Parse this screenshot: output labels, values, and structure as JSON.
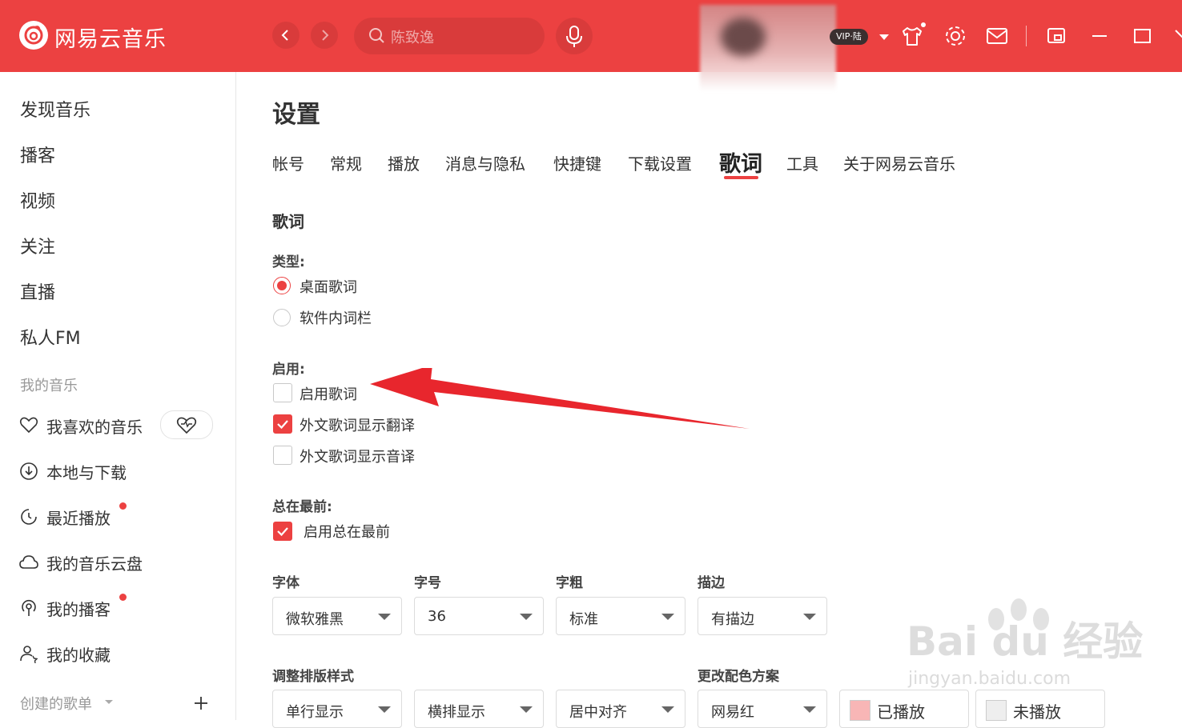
{
  "app": {
    "title": "网易云音乐",
    "search_placeholder": "陈致逸",
    "vip_badge": "VIP·陆",
    "accent_color": "#ec4141"
  },
  "sidebar": {
    "main_items": [
      "发现音乐",
      "播客",
      "视频",
      "关注",
      "直播",
      "私人FM"
    ],
    "my_music_label": "我的音乐",
    "my_items": [
      {
        "label": "我喜欢的音乐",
        "icon": "heart-icon",
        "dot": false
      },
      {
        "label": "本地与下载",
        "icon": "download-icon",
        "dot": false
      },
      {
        "label": "最近播放",
        "icon": "recent-play-icon",
        "dot": true
      },
      {
        "label": "我的音乐云盘",
        "icon": "cloud-icon",
        "dot": false
      },
      {
        "label": "我的播客",
        "icon": "podcast-icon",
        "dot": true
      },
      {
        "label": "我的收藏",
        "icon": "collection-icon",
        "dot": false
      }
    ],
    "created_playlists_label": "创建的歌单"
  },
  "settings": {
    "title": "设置",
    "tabs": [
      "帐号",
      "常规",
      "播放",
      "消息与隐私",
      "快捷键",
      "下载设置",
      "歌词",
      "工具",
      "关于网易云音乐"
    ],
    "active_tab": "歌词",
    "section_title": "歌词",
    "type_label": "类型:",
    "type_options": [
      {
        "label": "桌面歌词",
        "selected": true
      },
      {
        "label": "软件内词栏",
        "selected": false
      }
    ],
    "enable_label": "启用:",
    "enable_options": [
      {
        "label": "启用歌词",
        "checked": false
      },
      {
        "label": "外文歌词显示翻译",
        "checked": true
      },
      {
        "label": "外文歌词显示音译",
        "checked": false
      }
    ],
    "always_on_top_label": "总在最前:",
    "always_on_top_option": {
      "label": "启用总在最前",
      "checked": true
    },
    "font_labels": [
      "字体",
      "字号",
      "字粗",
      "描边"
    ],
    "font_values": [
      "微软雅黑",
      "36",
      "标准",
      "有描边"
    ],
    "layout_label": "调整排版样式",
    "color_label": "更改配色方案",
    "layout_values": [
      "单行显示",
      "横排显示",
      "居中对齐"
    ],
    "color_scheme_value": "网易红",
    "played_label": "已播放",
    "unplayed_label": "未播放",
    "played_color": "#f8b6b6",
    "unplayed_color": "#eeeeee"
  },
  "watermark": {
    "brand": "Bai du 经验",
    "url": "jingyan.baidu.com"
  }
}
